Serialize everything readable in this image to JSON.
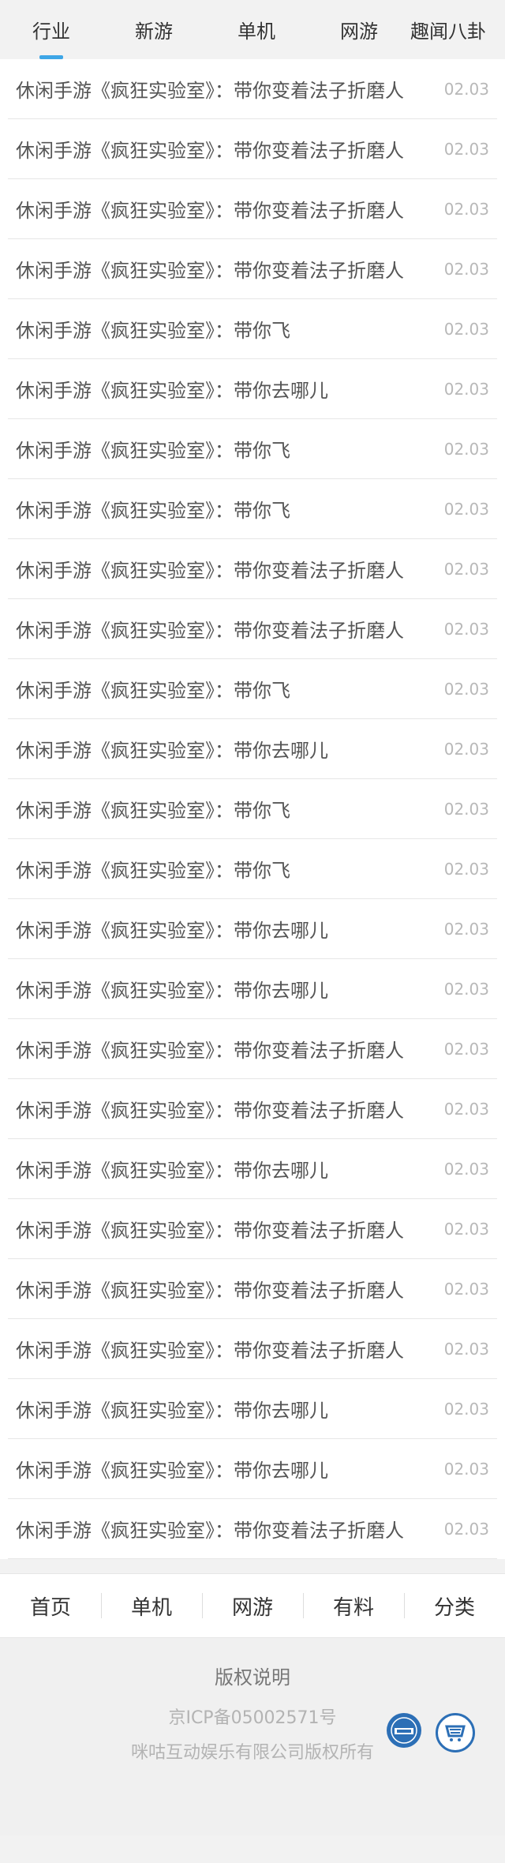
{
  "top_tabs": [
    "行业",
    "新游",
    "单机",
    "网游",
    "趣闻八卦"
  ],
  "active_tab": "行业",
  "news": [
    {
      "title": "休闲手游《疯狂实验室》：带你变着法子折磨人",
      "date": "02.03"
    },
    {
      "title": "休闲手游《疯狂实验室》：带你变着法子折磨人",
      "date": "02.03"
    },
    {
      "title": "休闲手游《疯狂实验室》：带你变着法子折磨人",
      "date": "02.03"
    },
    {
      "title": "休闲手游《疯狂实验室》：带你变着法子折磨人",
      "date": "02.03"
    },
    {
      "title": "休闲手游《疯狂实验室》：带你飞",
      "date": "02.03"
    },
    {
      "title": "休闲手游《疯狂实验室》：带你去哪儿",
      "date": "02.03"
    },
    {
      "title": "休闲手游《疯狂实验室》：带你飞",
      "date": "02.03"
    },
    {
      "title": "休闲手游《疯狂实验室》：带你飞",
      "date": "02.03"
    },
    {
      "title": "休闲手游《疯狂实验室》：带你变着法子折磨人",
      "date": "02.03"
    },
    {
      "title": "休闲手游《疯狂实验室》：带你变着法子折磨人",
      "date": "02.03"
    },
    {
      "title": "休闲手游《疯狂实验室》：带你飞",
      "date": "02.03"
    },
    {
      "title": "休闲手游《疯狂实验室》：带你去哪儿",
      "date": "02.03"
    },
    {
      "title": "休闲手游《疯狂实验室》：带你飞",
      "date": "02.03"
    },
    {
      "title": "休闲手游《疯狂实验室》：带你飞",
      "date": "02.03"
    },
    {
      "title": "休闲手游《疯狂实验室》：带你去哪儿",
      "date": "02.03"
    },
    {
      "title": "休闲手游《疯狂实验室》：带你去哪儿",
      "date": "02.03"
    },
    {
      "title": "休闲手游《疯狂实验室》：带你变着法子折磨人",
      "date": "02.03"
    },
    {
      "title": "休闲手游《疯狂实验室》：带你变着法子折磨人",
      "date": "02.03"
    },
    {
      "title": "休闲手游《疯狂实验室》：带你去哪儿",
      "date": "02.03"
    },
    {
      "title": "休闲手游《疯狂实验室》：带你变着法子折磨人",
      "date": "02.03"
    },
    {
      "title": "休闲手游《疯狂实验室》：带你变着法子折磨人",
      "date": "02.03"
    },
    {
      "title": "休闲手游《疯狂实验室》：带你变着法子折磨人",
      "date": "02.03"
    },
    {
      "title": "休闲手游《疯狂实验室》：带你去哪儿",
      "date": "02.03"
    },
    {
      "title": "休闲手游《疯狂实验室》：带你去哪儿",
      "date": "02.03"
    },
    {
      "title": "休闲手游《疯狂实验室》：带你变着法子折磨人",
      "date": "02.03"
    }
  ],
  "bottom_nav": [
    "首页",
    "单机",
    "网游",
    "有料",
    "分类"
  ],
  "footer": {
    "copyright": "版权说明",
    "icp": "京ICP备05002571号",
    "company": "咪咕互动娱乐有限公司版权所有",
    "badges": [
      "whitelist-badge-icon",
      "shop-badge-icon"
    ]
  },
  "colors": {
    "accent": "#3ea6e6",
    "badge": "#2c6fb6"
  }
}
